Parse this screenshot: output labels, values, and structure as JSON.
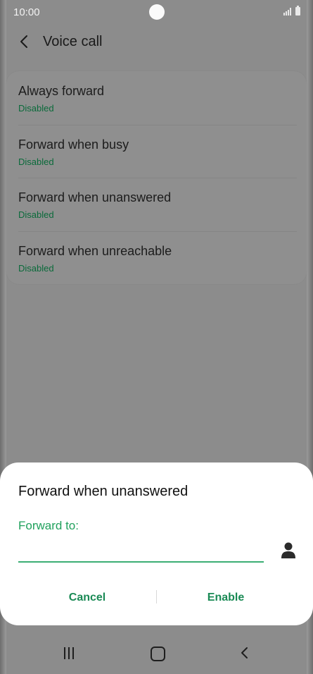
{
  "status_bar": {
    "time": "10:00"
  },
  "header": {
    "title": "Voice call"
  },
  "list": {
    "items": [
      {
        "title": "Always forward",
        "status": "Disabled"
      },
      {
        "title": "Forward when busy",
        "status": "Disabled"
      },
      {
        "title": "Forward when unanswered",
        "status": "Disabled"
      },
      {
        "title": "Forward when unreachable",
        "status": "Disabled"
      }
    ]
  },
  "dialog": {
    "title": "Forward when unanswered",
    "field_label": "Forward to:",
    "field_value": "",
    "cancel_label": "Cancel",
    "enable_label": "Enable"
  },
  "colors": {
    "accent": "#21a15d",
    "status_green": "#0a6a3a",
    "dim_background": "#8c8c8c"
  },
  "icons": {
    "back": "chevron-left-icon",
    "contact": "person-icon",
    "nav_recents": "recents-icon",
    "nav_home": "home-icon",
    "nav_back": "back-icon"
  }
}
